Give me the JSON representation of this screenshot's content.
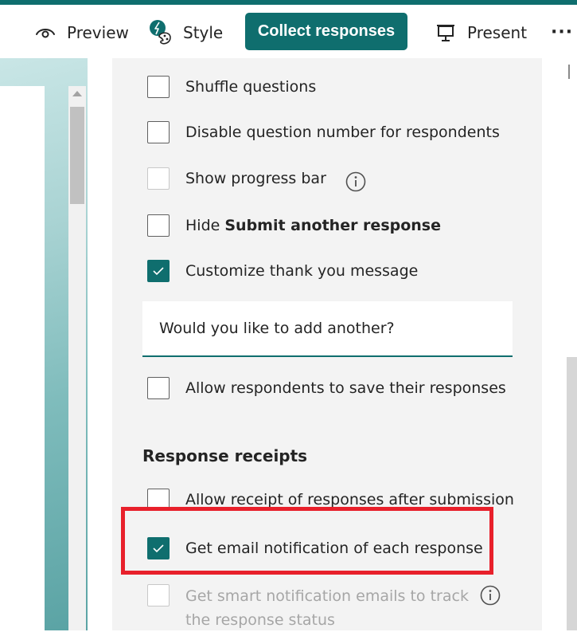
{
  "toolbar": {
    "preview_label": "Preview",
    "style_label": "Style",
    "collect_label": "Collect responses",
    "present_label": "Present",
    "more_label": "···"
  },
  "settings": {
    "shuffle": {
      "label": "Shuffle questions",
      "checked": false
    },
    "disable_qnum": {
      "label": "Disable question number for respondents",
      "checked": false
    },
    "progress": {
      "label": "Show progress bar",
      "checked": false,
      "disabled": true
    },
    "hide_submit": {
      "label_prefix": "Hide ",
      "label_bold": "Submit another response",
      "checked": false
    },
    "customize_thanks": {
      "label": "Customize thank you message",
      "checked": true
    },
    "thank_you_message": "Would you like to add another?",
    "allow_save": {
      "label": "Allow respondents to save their responses",
      "checked": false
    }
  },
  "receipts": {
    "title": "Response receipts",
    "allow_receipt": {
      "label": "Allow receipt of responses after submission",
      "checked": false
    },
    "email_notify": {
      "label": "Get email notification of each response",
      "checked": true
    },
    "smart_notify": {
      "label": "Get smart notification emails to track the response status",
      "checked": false,
      "disabled": true
    }
  },
  "colors": {
    "accent": "#0f6e6e",
    "highlight": "#e8202b",
    "panel": "#f3f3f3"
  }
}
